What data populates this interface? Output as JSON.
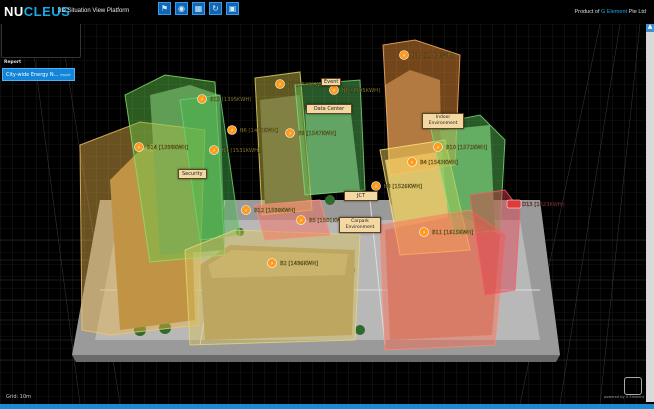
{
  "header": {
    "logo_nu": "NU",
    "logo_cleus": "CLEUS",
    "subtitle": "3D Situation View Platform",
    "product_prefix": "Product of ",
    "product_brand": "G Element",
    "product_suffix": " Pte Ltd"
  },
  "toolbar": {
    "buttons": [
      {
        "name": "flag-icon",
        "glyph": "⚑"
      },
      {
        "name": "camera-icon",
        "glyph": "◉"
      },
      {
        "name": "grid-icon",
        "glyph": "▦"
      },
      {
        "name": "rotate-icon",
        "glyph": "↻"
      },
      {
        "name": "image-icon",
        "glyph": "▣"
      }
    ]
  },
  "sidebar": {
    "report_label": "Report",
    "report_item": "City-wide Energy N...",
    "report_item_suffix": "report"
  },
  "markers": [
    {
      "id": "m1",
      "label": "B13 [1553KWH]",
      "color": "#ff9a1a"
    },
    {
      "id": "m2",
      "label": "B7 [1503KWH]",
      "color": "#ff9a1a"
    },
    {
      "id": "m3",
      "label": "B8 [1595KWH]",
      "color": "#ff9a1a"
    },
    {
      "id": "m4",
      "label": "B15 [1395KWH]",
      "color": "#ff9a1a"
    },
    {
      "id": "m5",
      "label": "B6 [1472KWH]",
      "color": "#ff9a1a"
    },
    {
      "id": "m6",
      "label": "B9 [1547KWH]",
      "color": "#ff9a1a"
    },
    {
      "id": "m7",
      "label": "B1 [1531KWH]",
      "color": "#ff9a1a"
    },
    {
      "id": "m8",
      "label": "B14 [1399KWH]",
      "color": "#ff9a1a"
    },
    {
      "id": "m9",
      "label": "B10 [1572KWH]",
      "color": "#ff9a1a"
    },
    {
      "id": "m10",
      "label": "B4 [1543KWH]",
      "color": "#ff9a1a"
    },
    {
      "id": "m11",
      "label": "B3 [1526KWH]",
      "color": "#ff9a1a"
    },
    {
      "id": "m12",
      "label": "B2 [1496KWH]",
      "color": "#ff9a1a"
    },
    {
      "id": "m13",
      "label": "B5 [1501KWH]",
      "color": "#ff9a1a"
    },
    {
      "id": "m14",
      "label": "B11 [1615KWH]",
      "color": "#ff9a1a"
    },
    {
      "id": "m15",
      "label": "B12 [1598KWH]",
      "color": "#ff9a1a"
    },
    {
      "id": "m16",
      "label": "D13 [1623KWH]",
      "color": "#e03a3a"
    }
  ],
  "tags": {
    "security": "Security",
    "data_center": "Data Center",
    "outdoor_env": "Indoor Environment",
    "jct": "JCT",
    "carpark_env": "Carpark Environment",
    "event": "Event"
  },
  "footer": {
    "grid_label": "Grid: 10m",
    "corner_text": "powered by G Element"
  },
  "colors": {
    "accent": "#19a9e6",
    "marker_text": "#ffe24a",
    "marker_text_alert": "#ff6a6a"
  }
}
